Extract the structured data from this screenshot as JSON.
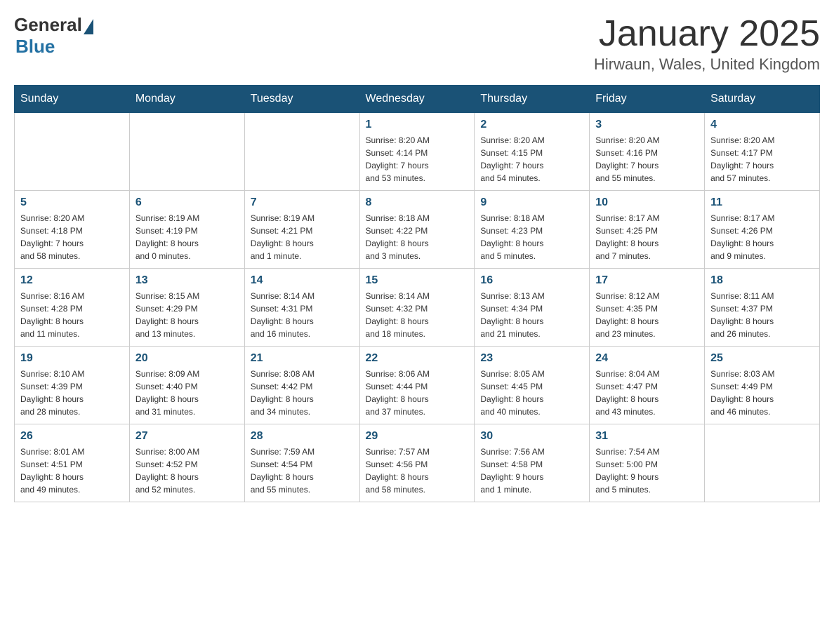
{
  "logo": {
    "general": "General",
    "blue": "Blue"
  },
  "title": "January 2025",
  "location": "Hirwaun, Wales, United Kingdom",
  "days_of_week": [
    "Sunday",
    "Monday",
    "Tuesday",
    "Wednesday",
    "Thursday",
    "Friday",
    "Saturday"
  ],
  "weeks": [
    [
      {
        "day": "",
        "info": ""
      },
      {
        "day": "",
        "info": ""
      },
      {
        "day": "",
        "info": ""
      },
      {
        "day": "1",
        "info": "Sunrise: 8:20 AM\nSunset: 4:14 PM\nDaylight: 7 hours\nand 53 minutes."
      },
      {
        "day": "2",
        "info": "Sunrise: 8:20 AM\nSunset: 4:15 PM\nDaylight: 7 hours\nand 54 minutes."
      },
      {
        "day": "3",
        "info": "Sunrise: 8:20 AM\nSunset: 4:16 PM\nDaylight: 7 hours\nand 55 minutes."
      },
      {
        "day": "4",
        "info": "Sunrise: 8:20 AM\nSunset: 4:17 PM\nDaylight: 7 hours\nand 57 minutes."
      }
    ],
    [
      {
        "day": "5",
        "info": "Sunrise: 8:20 AM\nSunset: 4:18 PM\nDaylight: 7 hours\nand 58 minutes."
      },
      {
        "day": "6",
        "info": "Sunrise: 8:19 AM\nSunset: 4:19 PM\nDaylight: 8 hours\nand 0 minutes."
      },
      {
        "day": "7",
        "info": "Sunrise: 8:19 AM\nSunset: 4:21 PM\nDaylight: 8 hours\nand 1 minute."
      },
      {
        "day": "8",
        "info": "Sunrise: 8:18 AM\nSunset: 4:22 PM\nDaylight: 8 hours\nand 3 minutes."
      },
      {
        "day": "9",
        "info": "Sunrise: 8:18 AM\nSunset: 4:23 PM\nDaylight: 8 hours\nand 5 minutes."
      },
      {
        "day": "10",
        "info": "Sunrise: 8:17 AM\nSunset: 4:25 PM\nDaylight: 8 hours\nand 7 minutes."
      },
      {
        "day": "11",
        "info": "Sunrise: 8:17 AM\nSunset: 4:26 PM\nDaylight: 8 hours\nand 9 minutes."
      }
    ],
    [
      {
        "day": "12",
        "info": "Sunrise: 8:16 AM\nSunset: 4:28 PM\nDaylight: 8 hours\nand 11 minutes."
      },
      {
        "day": "13",
        "info": "Sunrise: 8:15 AM\nSunset: 4:29 PM\nDaylight: 8 hours\nand 13 minutes."
      },
      {
        "day": "14",
        "info": "Sunrise: 8:14 AM\nSunset: 4:31 PM\nDaylight: 8 hours\nand 16 minutes."
      },
      {
        "day": "15",
        "info": "Sunrise: 8:14 AM\nSunset: 4:32 PM\nDaylight: 8 hours\nand 18 minutes."
      },
      {
        "day": "16",
        "info": "Sunrise: 8:13 AM\nSunset: 4:34 PM\nDaylight: 8 hours\nand 21 minutes."
      },
      {
        "day": "17",
        "info": "Sunrise: 8:12 AM\nSunset: 4:35 PM\nDaylight: 8 hours\nand 23 minutes."
      },
      {
        "day": "18",
        "info": "Sunrise: 8:11 AM\nSunset: 4:37 PM\nDaylight: 8 hours\nand 26 minutes."
      }
    ],
    [
      {
        "day": "19",
        "info": "Sunrise: 8:10 AM\nSunset: 4:39 PM\nDaylight: 8 hours\nand 28 minutes."
      },
      {
        "day": "20",
        "info": "Sunrise: 8:09 AM\nSunset: 4:40 PM\nDaylight: 8 hours\nand 31 minutes."
      },
      {
        "day": "21",
        "info": "Sunrise: 8:08 AM\nSunset: 4:42 PM\nDaylight: 8 hours\nand 34 minutes."
      },
      {
        "day": "22",
        "info": "Sunrise: 8:06 AM\nSunset: 4:44 PM\nDaylight: 8 hours\nand 37 minutes."
      },
      {
        "day": "23",
        "info": "Sunrise: 8:05 AM\nSunset: 4:45 PM\nDaylight: 8 hours\nand 40 minutes."
      },
      {
        "day": "24",
        "info": "Sunrise: 8:04 AM\nSunset: 4:47 PM\nDaylight: 8 hours\nand 43 minutes."
      },
      {
        "day": "25",
        "info": "Sunrise: 8:03 AM\nSunset: 4:49 PM\nDaylight: 8 hours\nand 46 minutes."
      }
    ],
    [
      {
        "day": "26",
        "info": "Sunrise: 8:01 AM\nSunset: 4:51 PM\nDaylight: 8 hours\nand 49 minutes."
      },
      {
        "day": "27",
        "info": "Sunrise: 8:00 AM\nSunset: 4:52 PM\nDaylight: 8 hours\nand 52 minutes."
      },
      {
        "day": "28",
        "info": "Sunrise: 7:59 AM\nSunset: 4:54 PM\nDaylight: 8 hours\nand 55 minutes."
      },
      {
        "day": "29",
        "info": "Sunrise: 7:57 AM\nSunset: 4:56 PM\nDaylight: 8 hours\nand 58 minutes."
      },
      {
        "day": "30",
        "info": "Sunrise: 7:56 AM\nSunset: 4:58 PM\nDaylight: 9 hours\nand 1 minute."
      },
      {
        "day": "31",
        "info": "Sunrise: 7:54 AM\nSunset: 5:00 PM\nDaylight: 9 hours\nand 5 minutes."
      },
      {
        "day": "",
        "info": ""
      }
    ]
  ]
}
